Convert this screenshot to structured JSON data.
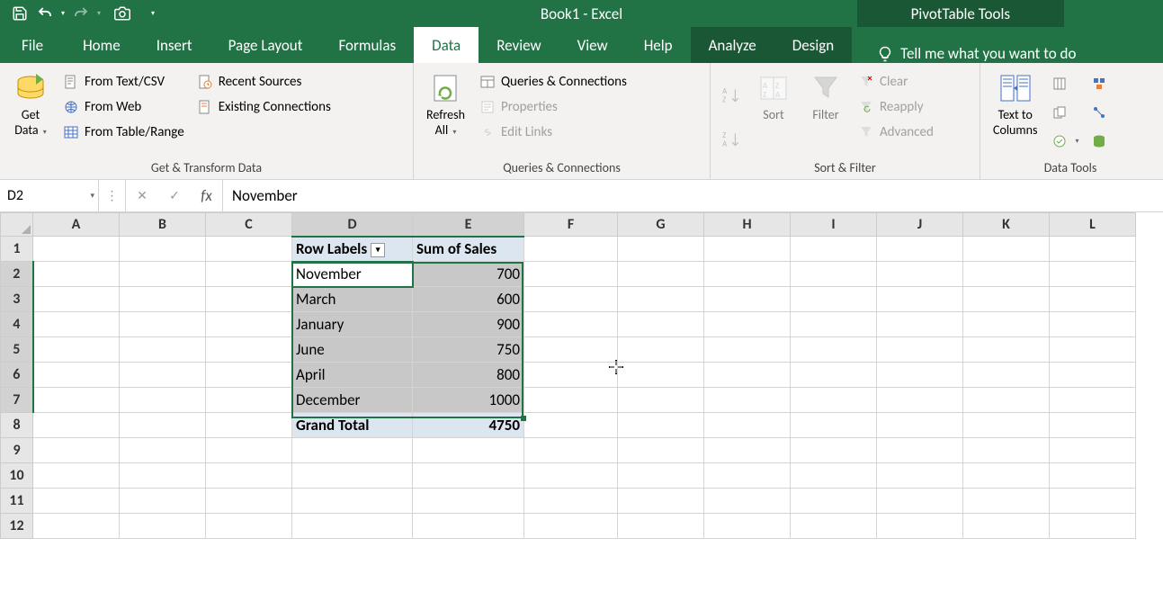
{
  "app": {
    "title": "Book1  -  Excel",
    "context_tools": "PivotTable Tools"
  },
  "qat": {
    "save": "save-icon",
    "undo": "undo-icon",
    "redo": "redo-icon",
    "camera": "camera-icon"
  },
  "tabs": {
    "file": "File",
    "home": "Home",
    "insert": "Insert",
    "page_layout": "Page Layout",
    "formulas": "Formulas",
    "data": "Data",
    "review": "Review",
    "view": "View",
    "help": "Help",
    "analyze": "Analyze",
    "design": "Design",
    "tell_me": "Tell me what you want to do"
  },
  "ribbon": {
    "group1": {
      "label": "Get & Transform Data",
      "get_data": "Get\nData",
      "from_text": "From Text/CSV",
      "from_web": "From Web",
      "from_table": "From Table/Range",
      "recent_sources": "Recent Sources",
      "existing_conn": "Existing Connections"
    },
    "group2": {
      "label": "Queries & Connections",
      "refresh_all": "Refresh\nAll",
      "queries_conn": "Queries & Connections",
      "properties": "Properties",
      "edit_links": "Edit Links"
    },
    "group3": {
      "label": "Sort & Filter",
      "sort": "Sort",
      "filter": "Filter",
      "clear": "Clear",
      "reapply": "Reapply",
      "advanced": "Advanced"
    },
    "group4": {
      "label": "Data Tools",
      "text_to_cols": "Text to\nColumns"
    }
  },
  "name_box": "D2",
  "formula": "November",
  "columns": [
    "A",
    "B",
    "C",
    "D",
    "E",
    "F",
    "G",
    "H",
    "I",
    "J",
    "K",
    "L"
  ],
  "rows": [
    "1",
    "2",
    "3",
    "4",
    "5",
    "6",
    "7",
    "8",
    "9",
    "10",
    "11",
    "12"
  ],
  "pivot": {
    "header_row_labels": "Row Labels",
    "header_sum": "Sum of Sales",
    "data": [
      {
        "label": "November",
        "value": "700"
      },
      {
        "label": "March",
        "value": "600"
      },
      {
        "label": "January",
        "value": "900"
      },
      {
        "label": "June",
        "value": "750"
      },
      {
        "label": "April",
        "value": "800"
      },
      {
        "label": "December",
        "value": "1000"
      }
    ],
    "total_label": "Grand Total",
    "total_value": "4750"
  }
}
